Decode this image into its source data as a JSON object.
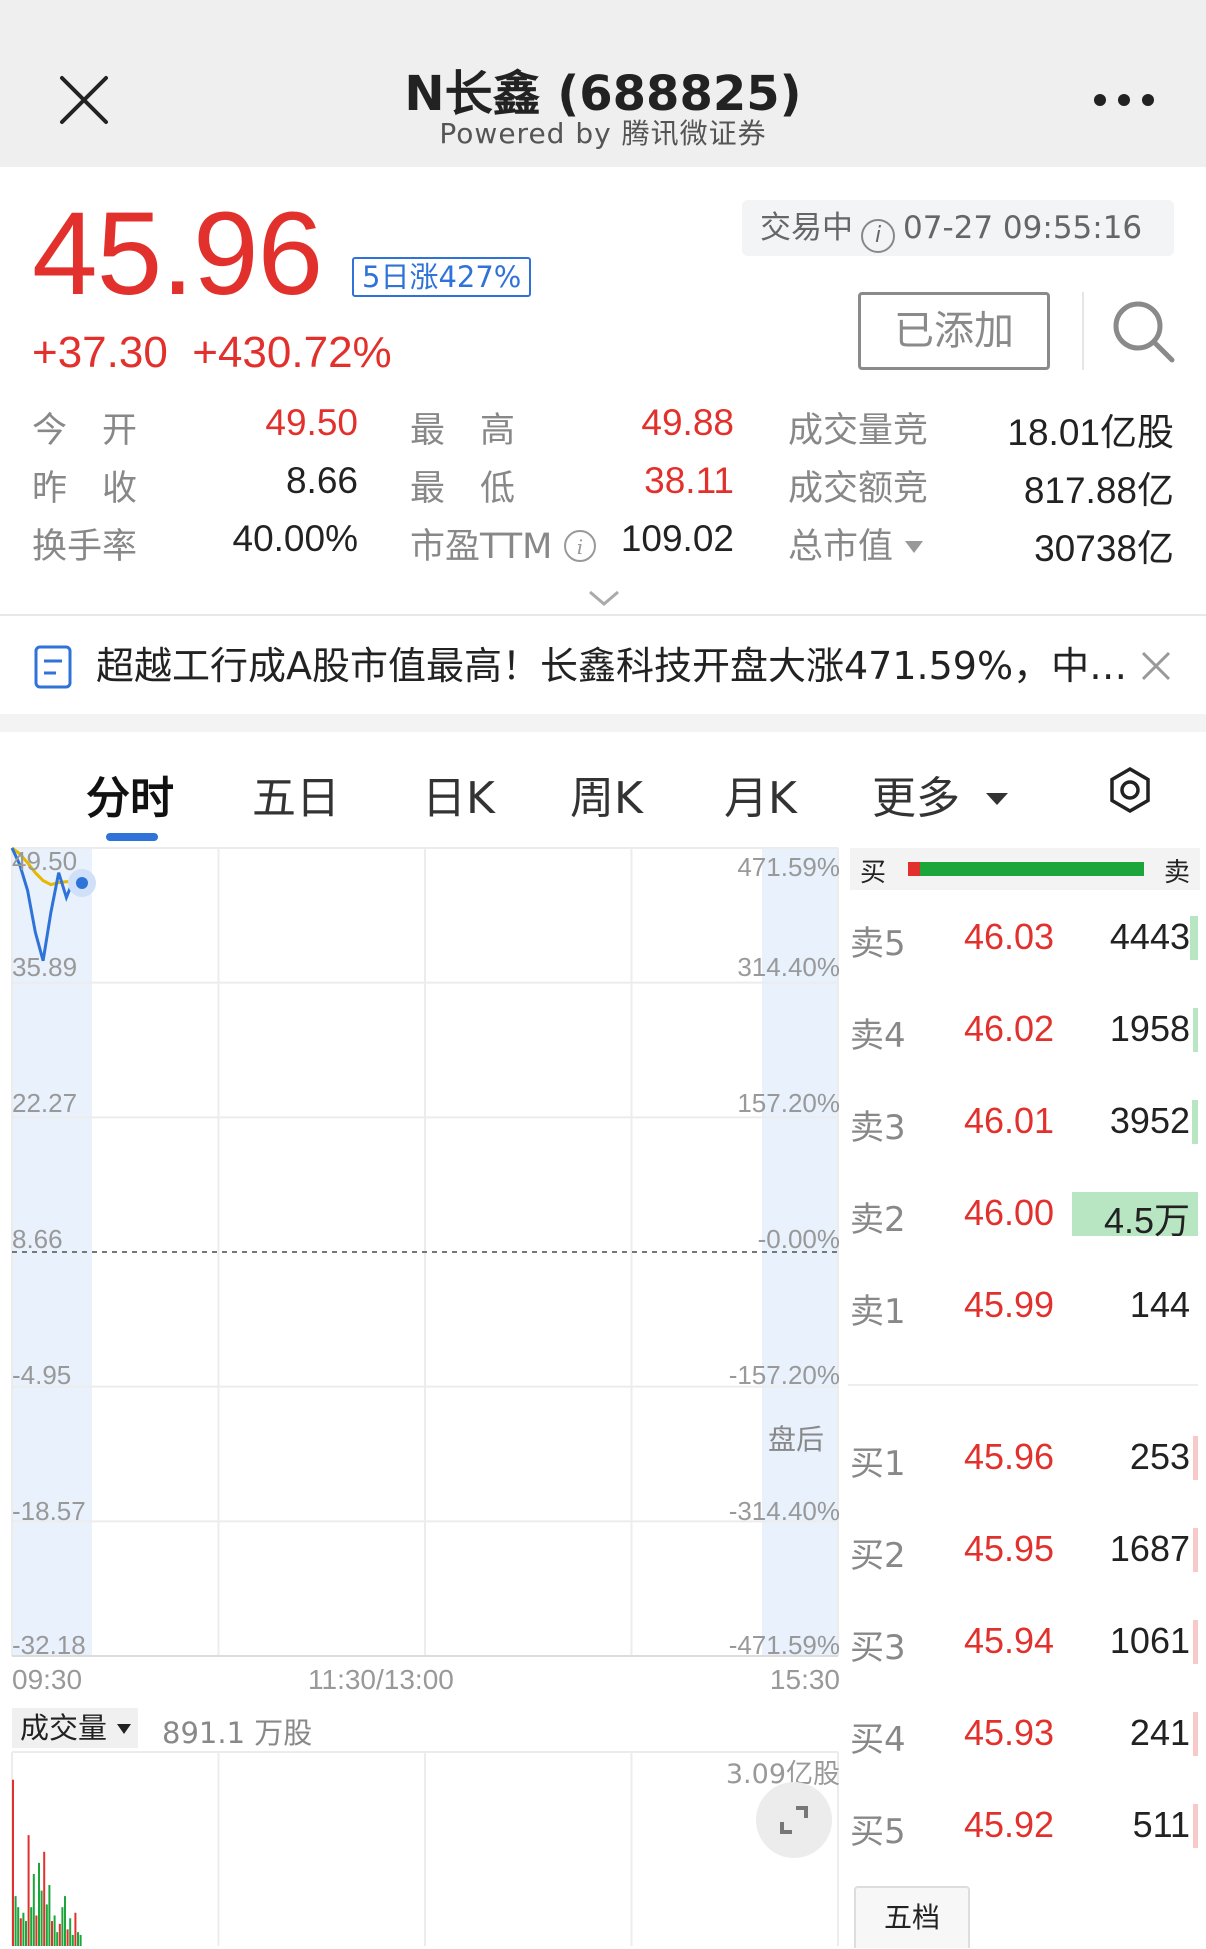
{
  "header": {
    "title": "N长鑫 (688825)",
    "subtitle": "Powered by 腾讯微证券"
  },
  "quote": {
    "price": "45.96",
    "badge": "5日涨427%",
    "change": "+37.30",
    "change_pct": "+430.72%",
    "status": "交易中",
    "datetime": "07-27 09:55:16",
    "added_button": "已添加",
    "stats": [
      {
        "label": "今　开",
        "value": "49.50",
        "color": "red"
      },
      {
        "label": "最　高",
        "value": "49.88",
        "color": "red"
      },
      {
        "label": "成交量竞",
        "value": "18.01亿股",
        "color": "dark"
      },
      {
        "label": "昨　收",
        "value": "8.66",
        "color": "dark"
      },
      {
        "label": "最　低",
        "value": "38.11",
        "color": "red"
      },
      {
        "label": "成交额竞",
        "value": "817.88亿",
        "color": "dark"
      },
      {
        "label": "换手率",
        "value": "40.00%",
        "color": "dark"
      },
      {
        "label": "市盈TTM",
        "value": "109.02",
        "color": "dark"
      },
      {
        "label": "总市值",
        "value": "30738亿",
        "color": "dark"
      }
    ]
  },
  "news": {
    "text": "超越工行成A股市值最高！长鑫科技开盘大涨471.59%，中…"
  },
  "tabs": [
    {
      "label": "分时",
      "active": true
    },
    {
      "label": "五日",
      "active": false
    },
    {
      "label": "日K",
      "active": false
    },
    {
      "label": "周K",
      "active": false
    },
    {
      "label": "月K",
      "active": false
    },
    {
      "label": "更多",
      "active": false
    }
  ],
  "chart_data": {
    "type": "line",
    "y_left_ticks": [
      "49.50",
      "35.89",
      "22.27",
      "8.66",
      "-4.95",
      "-18.57",
      "-32.18"
    ],
    "y_right_ticks": [
      "471.59%",
      "314.40%",
      "157.20%",
      "-0.00%",
      "-157.20%",
      "-314.40%",
      "-471.59%"
    ],
    "x_ticks": [
      "09:30",
      "11:30/13:00",
      "15:30"
    ],
    "ylim": [
      -32.18,
      49.5
    ],
    "baseline": 8.66,
    "after_hours_label": "盘后",
    "series": [
      {
        "values": [
          49.5,
          47.8,
          45.2,
          41.0,
          38.11,
          43.0,
          47.0,
          44.5,
          46.5,
          45.96
        ]
      },
      {
        "values": [
          49.5,
          48.9,
          48.0,
          47.0,
          46.2,
          45.8,
          46.0,
          46.1,
          46.0,
          45.96
        ]
      }
    ],
    "volume": {
      "label": "成交量",
      "current": "891.1 万股",
      "max_label": "3.09亿股"
    },
    "volume_bars": [
      60,
      18,
      14,
      10,
      12,
      9,
      40,
      14,
      26,
      11,
      30,
      20,
      34,
      15,
      22,
      9,
      11,
      5,
      8,
      14,
      18,
      6,
      10,
      4,
      12,
      5,
      4
    ],
    "volume_max": 70
  },
  "order_book": {
    "buy_label": "买",
    "sell_label": "卖",
    "buy_ratio": 0.05,
    "asks": [
      {
        "label": "卖5",
        "price": "46.03",
        "vol": "4443",
        "bar": 0.06
      },
      {
        "label": "卖4",
        "price": "46.02",
        "vol": "1958",
        "bar": 0.03
      },
      {
        "label": "卖3",
        "price": "46.01",
        "vol": "3952",
        "bar": 0.05
      },
      {
        "label": "卖2",
        "price": "46.00",
        "vol": "4.5万",
        "bar": 1.0
      },
      {
        "label": "卖1",
        "price": "45.99",
        "vol": "144",
        "bar": 0.0
      }
    ],
    "bids": [
      {
        "label": "买1",
        "price": "45.96",
        "vol": "253",
        "bar": 0.01
      },
      {
        "label": "买2",
        "price": "45.95",
        "vol": "1687",
        "bar": 0.03
      },
      {
        "label": "买3",
        "price": "45.94",
        "vol": "1061",
        "bar": 0.02
      },
      {
        "label": "买4",
        "price": "45.93",
        "vol": "241",
        "bar": 0.01
      },
      {
        "label": "买5",
        "price": "45.92",
        "vol": "511",
        "bar": 0.01
      }
    ],
    "footer_tab": "五档"
  },
  "colors": {
    "red": "#e2312d",
    "green": "#1ca53a",
    "blue": "#2f72d8",
    "light_green": "#b8e6c2",
    "light_red": "#f7c9c9"
  }
}
